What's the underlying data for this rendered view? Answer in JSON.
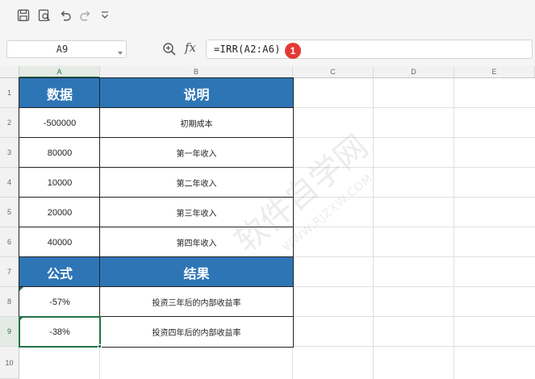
{
  "toolbar": {
    "icons": [
      "save-icon",
      "print-preview-icon",
      "undo-icon",
      "redo-icon",
      "customize-dropdown-icon"
    ]
  },
  "formula_bar": {
    "name_box": "A9",
    "fx_label": "fx",
    "formula": "=IRR(A2:A6)",
    "step_badge": "1"
  },
  "columns": [
    "A",
    "B",
    "C",
    "D",
    "E"
  ],
  "rows": [
    "1",
    "2",
    "3",
    "4",
    "5",
    "6",
    "7",
    "8",
    "9",
    "10"
  ],
  "table": {
    "header1": {
      "a": "数据",
      "b": "说明"
    },
    "data_rows": [
      {
        "a": "-500000",
        "b": "初期成本"
      },
      {
        "a": "80000",
        "b": "第一年收入"
      },
      {
        "a": "10000",
        "b": "第二年收入"
      },
      {
        "a": "20000",
        "b": "第三年收入"
      },
      {
        "a": "40000",
        "b": "第四年收入"
      }
    ],
    "header2": {
      "a": "公式",
      "b": "结果"
    },
    "result_rows": [
      {
        "a": "-57%",
        "b": "投资三年后的内部收益率"
      },
      {
        "a": "-38%",
        "b": "投资四年后的内部收益率"
      }
    ]
  },
  "colors": {
    "header_fill": "#2e75b6",
    "selection": "#217346",
    "badge": "#e53935"
  },
  "watermark": {
    "line1": "软件自学网",
    "line2": "WWW.RJZXW.COM"
  }
}
